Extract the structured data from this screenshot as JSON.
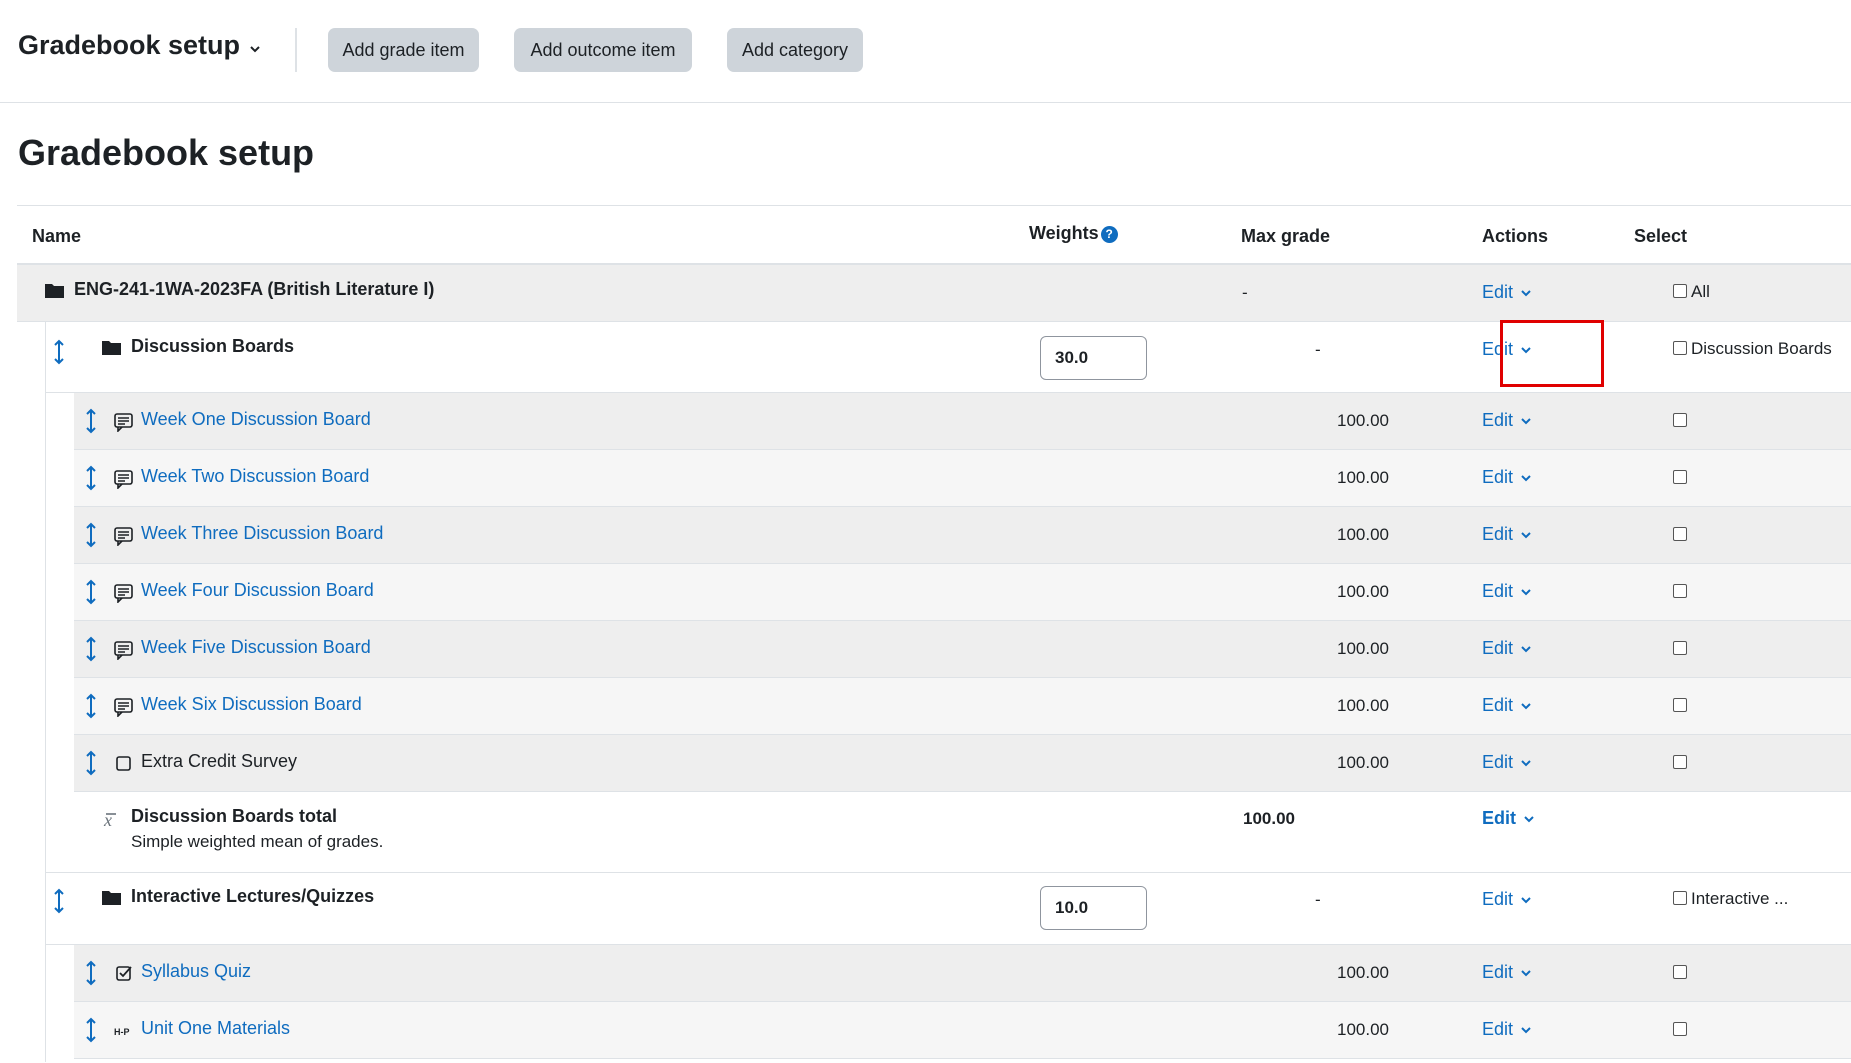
{
  "header": {
    "selector_label": "Gradebook setup",
    "buttons": [
      "Add grade item",
      "Add outcome item",
      "Add category"
    ]
  },
  "page_title": "Gradebook setup",
  "columns": {
    "name": "Name",
    "weights": "Weights",
    "max_grade": "Max grade",
    "actions": "Actions",
    "select": "Select"
  },
  "course": {
    "name": "ENG-241-1WA-2023FA (British Literature I)",
    "max_grade": "-",
    "edit": "Edit",
    "select_label": "All"
  },
  "categories": [
    {
      "name": "Discussion Boards",
      "weight": "30.0",
      "max_grade": "-",
      "edit": "Edit",
      "select_label": "Discussion Boards",
      "items": [
        {
          "name": "Week One Discussion Board",
          "icon": "forum-icon",
          "max_grade": "100.00",
          "edit": "Edit",
          "link": true
        },
        {
          "name": "Week Two Discussion Board",
          "icon": "forum-icon",
          "max_grade": "100.00",
          "edit": "Edit",
          "link": true
        },
        {
          "name": "Week Three Discussion Board",
          "icon": "forum-icon",
          "max_grade": "100.00",
          "edit": "Edit",
          "link": true
        },
        {
          "name": "Week Four Discussion Board",
          "icon": "forum-icon",
          "max_grade": "100.00",
          "edit": "Edit",
          "link": true
        },
        {
          "name": "Week Five Discussion Board",
          "icon": "forum-icon",
          "max_grade": "100.00",
          "edit": "Edit",
          "link": true
        },
        {
          "name": "Week Six Discussion Board",
          "icon": "forum-icon",
          "max_grade": "100.00",
          "edit": "Edit",
          "link": true
        },
        {
          "name": "Extra Credit Survey",
          "icon": "manual-item-icon",
          "max_grade": "100.00",
          "edit": "Edit",
          "link": false
        }
      ],
      "total": {
        "name": "Discussion Boards total",
        "description": "Simple weighted mean of grades.",
        "max_grade": "100.00",
        "edit": "Edit"
      }
    },
    {
      "name": "Interactive Lectures/Quizzes",
      "weight": "10.0",
      "max_grade": "-",
      "edit": "Edit",
      "select_label": "Interactive ...",
      "items": [
        {
          "name": "Syllabus Quiz",
          "icon": "quiz-icon",
          "max_grade": "100.00",
          "edit": "Edit",
          "link": true
        },
        {
          "name": "Unit One Materials",
          "icon": "h5p-icon",
          "max_grade": "100.00",
          "edit": "Edit",
          "link": true
        }
      ]
    }
  ],
  "colors": {
    "link": "#0f6cbf",
    "highlight": "#e00000",
    "button_bg": "#ced4da"
  }
}
